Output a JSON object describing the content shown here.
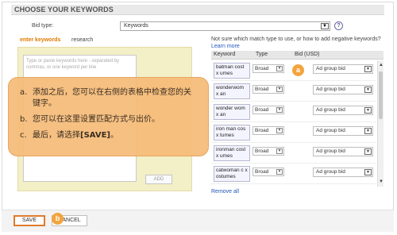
{
  "header": {
    "title": "CHOOSE YOUR KEYWORDS"
  },
  "bid_type": {
    "label": "Bid type:",
    "value": "Keywords",
    "help": "?"
  },
  "tabs": {
    "enter": "enter keywords",
    "research": "research"
  },
  "left": {
    "placeholder": "Type or paste keywords here - separated by commas, or one keyword per line",
    "add_label": "ADD"
  },
  "right": {
    "hint": "Not sure which match type to use, or how to add negative keywords?",
    "learn_more": "Learn more",
    "columns": {
      "keyword": "Keyword",
      "type": "Type",
      "bid": "Bid (USD)"
    },
    "rows": [
      {
        "keyword": "batman cost x umes",
        "type": "Broad",
        "bid": "Ad group bid"
      },
      {
        "keyword": "wonderwom x an costumes",
        "type": "Broad",
        "bid": "Ad group bid"
      },
      {
        "keyword": "wonder wom x an costumes",
        "type": "Broad",
        "bid": "Ad group bid"
      },
      {
        "keyword": "iron man cos x tumes",
        "type": "Broad",
        "bid": "Ad group bid"
      },
      {
        "keyword": "ironman cost x umes",
        "type": "Broad",
        "bid": "Ad group bid"
      },
      {
        "keyword": "catwoman c x ostumes",
        "type": "Broad",
        "bid": "Ad group bid"
      }
    ],
    "remove_all": "Remove all"
  },
  "footer": {
    "save": "SAVE",
    "cancel": "CANCEL"
  },
  "callouts": {
    "a": "a",
    "b": "b"
  },
  "overlay": {
    "lines": [
      {
        "mark": "a.",
        "text": "添加之后，您可以在右侧的表格中检查您的关键字。"
      },
      {
        "mark": "b.",
        "text": "您可以在这里设置匹配方式与出价。"
      },
      {
        "mark": "c.",
        "text_before": "最后，请选择",
        "text_bold": "[SAVE]",
        "text_after": "。"
      }
    ]
  },
  "colors": {
    "accent": "#e07a00",
    "callout": "#f3a43d",
    "overlay": "#f5bb78",
    "link": "#2255bb"
  }
}
